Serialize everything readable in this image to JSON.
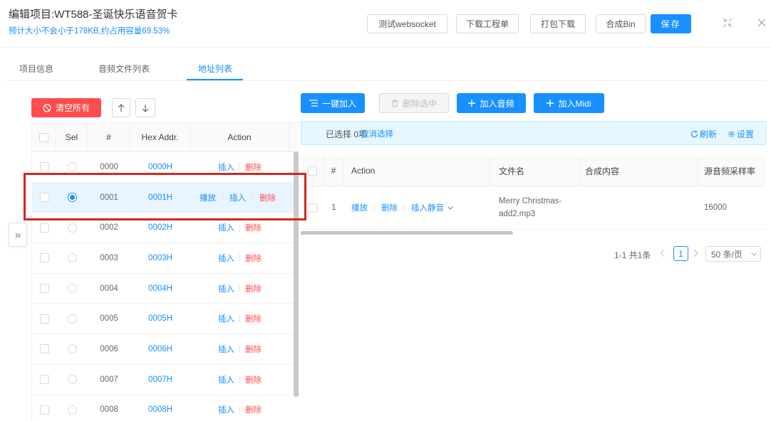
{
  "header": {
    "title": "编辑项目:WT588-圣诞快乐语音贺卡",
    "subtitle": "预计大小不会小于178KB,约占用容量69.53%",
    "test_websocket_label": "测试websocket",
    "download_worksheet_label": "下载工程单",
    "package_download_label": "打包下载",
    "compose_bin_label": "合成Bin",
    "save_label": "保存",
    "icons": [
      "fullscreen-exit-icon",
      "close-icon"
    ]
  },
  "tabs": [
    {
      "label": "项目信息",
      "active": false
    },
    {
      "label": "音频文件列表",
      "active": false
    },
    {
      "label": "地址列表",
      "active": true
    }
  ],
  "address_list": {
    "clear_all_label": "清空所有",
    "columns": {
      "sel": "Sel",
      "index": "#",
      "hex": "Hex Addr.",
      "action": "Action"
    },
    "rows": [
      {
        "index": "0000",
        "hex": "0000H",
        "selected": false,
        "actions": [
          "插入",
          "删除"
        ]
      },
      {
        "index": "0001",
        "hex": "0001H",
        "selected": true,
        "actions": [
          "播放",
          "插入",
          "删除"
        ]
      },
      {
        "index": "0002",
        "hex": "0002H",
        "selected": false,
        "actions": [
          "插入",
          "删除"
        ]
      },
      {
        "index": "0003",
        "hex": "0003H",
        "selected": false,
        "actions": [
          "插入",
          "删除"
        ]
      },
      {
        "index": "0004",
        "hex": "0004H",
        "selected": false,
        "actions": [
          "插入",
          "删除"
        ]
      },
      {
        "index": "0005",
        "hex": "0005H",
        "selected": false,
        "actions": [
          "插入",
          "删除"
        ]
      },
      {
        "index": "0006",
        "hex": "0006H",
        "selected": false,
        "actions": [
          "插入",
          "删除"
        ]
      },
      {
        "index": "0007",
        "hex": "0007H",
        "selected": false,
        "actions": [
          "插入",
          "删除"
        ]
      },
      {
        "index": "0008",
        "hex": "0008H",
        "selected": false,
        "actions": [
          "插入",
          "删除"
        ]
      }
    ],
    "expand_glyph": "»"
  },
  "audio_panel": {
    "toolbar": {
      "add_all_label": "一键加入",
      "delete_selected_label": "删除选中",
      "add_audio_label": "加入音频",
      "add_midi_label": "加入Midi"
    },
    "selection_bar": {
      "selected_text": "已选择 0项",
      "clear_selection_label": "取消选择",
      "refresh_label": "刷新",
      "settings_label": "设置"
    },
    "columns": {
      "index": "#",
      "action": "Action",
      "file_name": "文件名",
      "composed_content": "合成内容",
      "sample_rate": "源音频采样率"
    },
    "rows": [
      {
        "index": "1",
        "actions": [
          "播放",
          "删除",
          "插入静音"
        ],
        "file_name": "Merry Christmas-add2.mp3",
        "composed_content": "",
        "sample_rate": "16000"
      }
    ],
    "pagination": {
      "summary": "1-1 共1条",
      "current_page": "1",
      "page_size": "50 条/页"
    }
  },
  "colors": {
    "primary": "#1890ff",
    "danger": "#ff4d4f",
    "selected_row": "#e8f4ff",
    "info_bar": "#e6f7ff",
    "annotation": "#d0281e"
  }
}
